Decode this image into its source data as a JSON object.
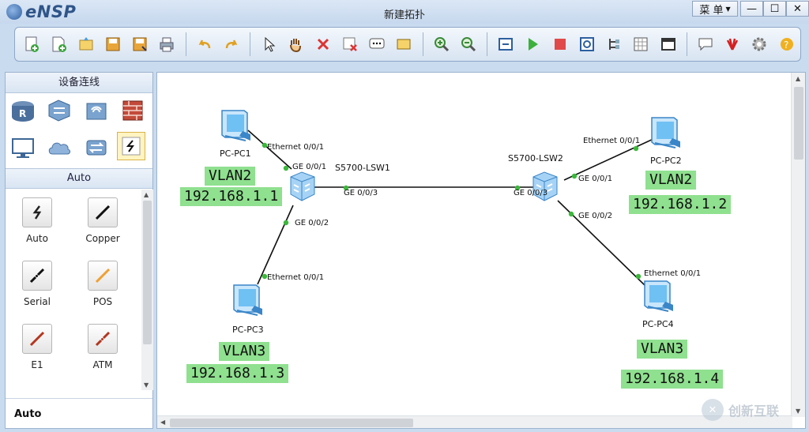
{
  "app": {
    "name": "eNSP",
    "window_title": "新建拓扑",
    "menu_label": "菜 单"
  },
  "window_controls": {
    "minimize": "—",
    "maximize": "☐",
    "close": "✕"
  },
  "toolbar": {
    "groups": [
      [
        "new-topology-icon",
        "new-file-icon",
        "open-icon",
        "save-icon",
        "save-as-icon",
        "print-icon"
      ],
      [
        "undo-icon",
        "redo-icon"
      ],
      [
        "select-icon",
        "pan-hand-icon",
        "delete-icon",
        "delete-link-icon",
        "text-annotation-icon",
        "rectangle-icon"
      ],
      [
        "zoom-in-icon",
        "zoom-out-icon",
        "fit-view-icon"
      ],
      [
        "start-device-icon",
        "stop-device-icon",
        "capture-icon",
        "topology-icon",
        "grid-icon",
        "console-icon"
      ],
      [
        "chat-icon",
        "huawei-logo-icon",
        "settings-icon",
        "help-icon"
      ]
    ]
  },
  "left_panel": {
    "header": "设备连线",
    "categories": [
      {
        "name": "router-icon",
        "label": "R"
      },
      {
        "name": "switch-icon"
      },
      {
        "name": "wireless-icon"
      },
      {
        "name": "firewall-icon"
      },
      {
        "name": "pc-terminal-icon"
      },
      {
        "name": "cloud-icon"
      },
      {
        "name": "other-devices-icon"
      },
      {
        "name": "connection-icon",
        "selected": true
      }
    ],
    "section_title": "Auto",
    "cables": [
      {
        "label": "Auto",
        "icon": "auto-cable-icon",
        "color": "#222222"
      },
      {
        "label": "Copper",
        "icon": "copper-cable-icon",
        "color": "#111111"
      },
      {
        "label": "Serial",
        "icon": "serial-cable-icon",
        "color": "#111111"
      },
      {
        "label": "POS",
        "icon": "pos-cable-icon",
        "color": "#f0a030"
      },
      {
        "label": "E1",
        "icon": "e1-cable-icon",
        "color": "#b5361f"
      },
      {
        "label": "ATM",
        "icon": "atm-cable-icon",
        "color": "#b5361f"
      }
    ],
    "footer": "Auto"
  },
  "topology": {
    "devices": [
      {
        "id": "pc1",
        "name": "PC-PC1",
        "type": "pc"
      },
      {
        "id": "pc2",
        "name": "PC-PC2",
        "type": "pc"
      },
      {
        "id": "pc3",
        "name": "PC-PC3",
        "type": "pc"
      },
      {
        "id": "pc4",
        "name": "PC-PC4",
        "type": "pc"
      },
      {
        "id": "lsw1",
        "name": "S5700-LSW1",
        "type": "switch"
      },
      {
        "id": "lsw2",
        "name": "S5700-LSW2",
        "type": "switch"
      }
    ],
    "ports": {
      "pc1_eth": "Ethernet 0/0/1",
      "lsw1_ge1": "GE 0/0/1",
      "lsw1_ge2": "GE 0/0/2",
      "lsw1_ge3": "GE 0/0/3",
      "pc3_eth": "Ethernet 0/0/1",
      "lsw2_ge3": "GE 0/0/3",
      "lsw2_ge1": "GE 0/0/1",
      "lsw2_ge2": "GE 0/0/2",
      "pc2_eth": "Ethernet 0/0/1",
      "pc4_eth": "Ethernet 0/0/1"
    },
    "tags": {
      "pc1_vlan": "VLAN2",
      "pc1_ip": "192.168.1.1",
      "pc2_vlan": "VLAN2",
      "pc2_ip": "192.168.1.2",
      "pc3_vlan": "VLAN3",
      "pc3_ip": "192.168.1.3",
      "pc4_vlan": "VLAN3",
      "pc4_ip": "192.168.1.4"
    },
    "link_color": "#111111",
    "port_dot_color": "#3cb83c",
    "tag_color": "#8fe08f"
  },
  "watermark": {
    "text": "创新互联",
    "mark": "✕"
  }
}
